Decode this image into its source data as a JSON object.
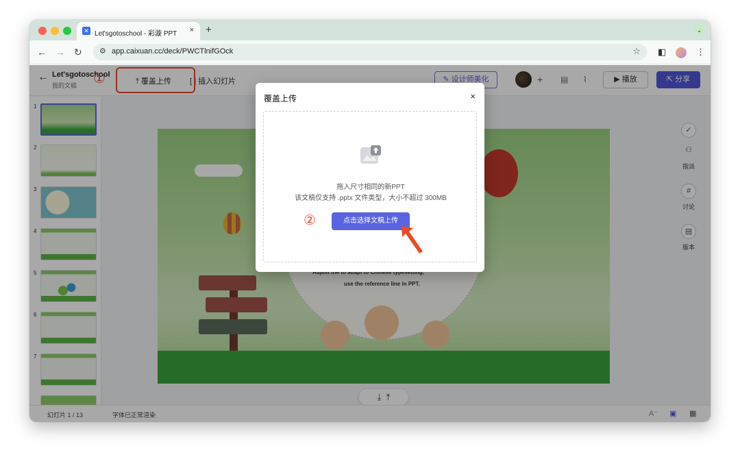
{
  "browser": {
    "tab_title": "Let'sgotoschool - 彩漩 PPT",
    "tab_close": "×",
    "new_tab": "+",
    "url": "app.caixuan.cc/deck/PWCTlnifGOck"
  },
  "app": {
    "doc_title": "Let'sgotoschool",
    "doc_subtitle": "我的文稿",
    "toolbar": {
      "overwrite_upload": "覆盖上传",
      "insert_slide": "插入幻灯片",
      "beautify": "设计师美化",
      "play": "播放",
      "share": "分享"
    },
    "step1": "①",
    "step2": "②",
    "thumbnails": [
      "1",
      "2",
      "3",
      "4",
      "5",
      "6",
      "7"
    ],
    "slide": {
      "caption1": "Adjust the           to adapt to Chinese  typesetting,",
      "caption2": "use the reference line in PPT."
    },
    "right_rail": [
      {
        "icon": "check-icon",
        "label": ""
      },
      {
        "icon": "assign-icon",
        "label": "指派"
      },
      {
        "icon": "discuss-icon",
        "label": "讨论"
      },
      {
        "icon": "version-icon",
        "label": "版本"
      }
    ],
    "status": {
      "slides": "幻灯片 1 / 13",
      "font": "字体已正常渲染"
    }
  },
  "modal": {
    "title": "覆盖上传",
    "close": "×",
    "line1": "拖入尺寸相同的新PPT",
    "line2": "该文稿仅支持 .pptx 文件类型，大小不超过 300MB",
    "select_button": "点击选择文稿上传"
  },
  "colors": {
    "accent": "#5a63e0",
    "annotation": "#ec4a2a"
  }
}
